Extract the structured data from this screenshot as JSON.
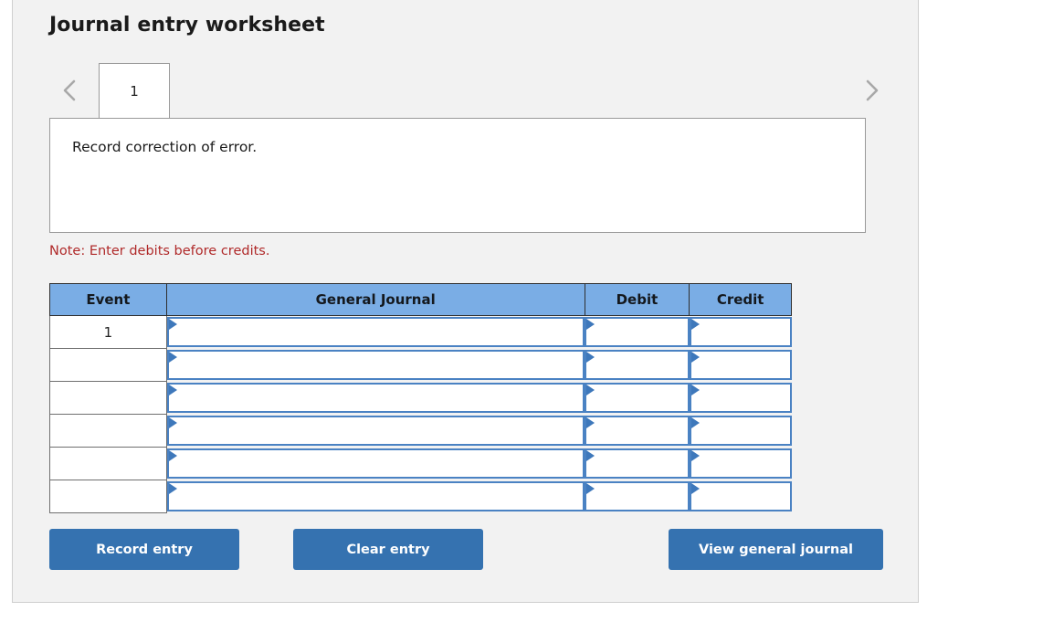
{
  "worksheet": {
    "title": "Journal entry worksheet",
    "nav": {
      "prev_icon": "chevron-left-icon",
      "next_icon": "chevron-right-icon"
    },
    "tabs": [
      {
        "label": "1",
        "active": true
      }
    ],
    "description": "Record correction of error.",
    "note": "Note: Enter debits before credits."
  },
  "table": {
    "headers": [
      "Event",
      "General Journal",
      "Debit",
      "Credit"
    ],
    "rows": [
      {
        "event": "1",
        "general_journal": "",
        "debit": "",
        "credit": ""
      },
      {
        "event": "",
        "general_journal": "",
        "debit": "",
        "credit": ""
      },
      {
        "event": "",
        "general_journal": "",
        "debit": "",
        "credit": ""
      },
      {
        "event": "",
        "general_journal": "",
        "debit": "",
        "credit": ""
      },
      {
        "event": "",
        "general_journal": "",
        "debit": "",
        "credit": ""
      },
      {
        "event": "",
        "general_journal": "",
        "debit": "",
        "credit": ""
      }
    ]
  },
  "actions": {
    "record": "Record entry",
    "clear": "Clear entry",
    "view": "View general journal"
  },
  "colors": {
    "header_blue": "#7aade5",
    "button_blue": "#3572b0",
    "cell_border_blue": "#4a82c3",
    "note_red": "#b02a2a",
    "panel_bg": "#f2f2f2"
  }
}
